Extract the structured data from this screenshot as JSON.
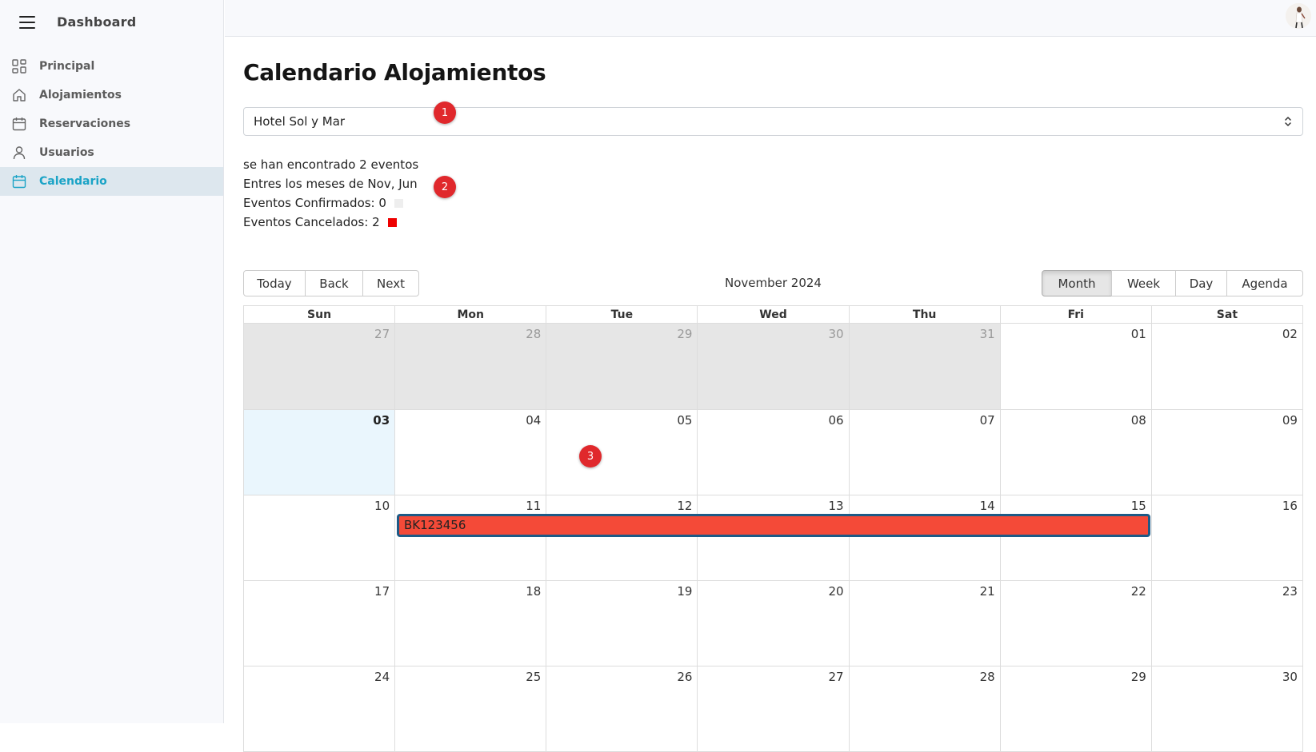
{
  "sidebar": {
    "title": "Dashboard",
    "items": [
      {
        "label": "Principal",
        "icon": "grid-icon"
      },
      {
        "label": "Alojamientos",
        "icon": "home-icon"
      },
      {
        "label": "Reservaciones",
        "icon": "calendar-icon"
      },
      {
        "label": "Usuarios",
        "icon": "user-icon"
      },
      {
        "label": "Calendario",
        "icon": "calendar-icon",
        "active": true
      }
    ]
  },
  "page": {
    "title": "Calendario Alojamientos",
    "select_value": "Hotel Sol y Mar",
    "info": {
      "found": "se han encontrado 2 eventos",
      "months": "Entres los meses de Nov, Jun",
      "confirmed": "Eventos Confirmados: 0",
      "cancelled": "Eventos Cancelados: 2"
    },
    "confirmed_color": "#eeeeee",
    "cancelled_color": "#ee0000"
  },
  "badges": [
    "1",
    "2",
    "3"
  ],
  "toolbar": {
    "nav": [
      "Today",
      "Back",
      "Next"
    ],
    "label": "November 2024",
    "views": [
      "Month",
      "Week",
      "Day",
      "Agenda"
    ],
    "active_view": "Month"
  },
  "calendar": {
    "weekdays": [
      "Sun",
      "Mon",
      "Tue",
      "Wed",
      "Thu",
      "Fri",
      "Sat"
    ],
    "weeks": [
      [
        "27",
        "28",
        "29",
        "30",
        "31",
        "01",
        "02"
      ],
      [
        "03",
        "04",
        "05",
        "06",
        "07",
        "08",
        "09"
      ],
      [
        "10",
        "11",
        "12",
        "13",
        "14",
        "15",
        "16"
      ],
      [
        "17",
        "18",
        "19",
        "20",
        "21",
        "22",
        "23"
      ],
      [
        "24",
        "25",
        "26",
        "27",
        "28",
        "29",
        "30"
      ]
    ],
    "today": "03",
    "events": [
      {
        "title": "BK123456",
        "start": "11",
        "end": "15",
        "status": "Cancelado",
        "color": "#f44a38"
      }
    ]
  }
}
